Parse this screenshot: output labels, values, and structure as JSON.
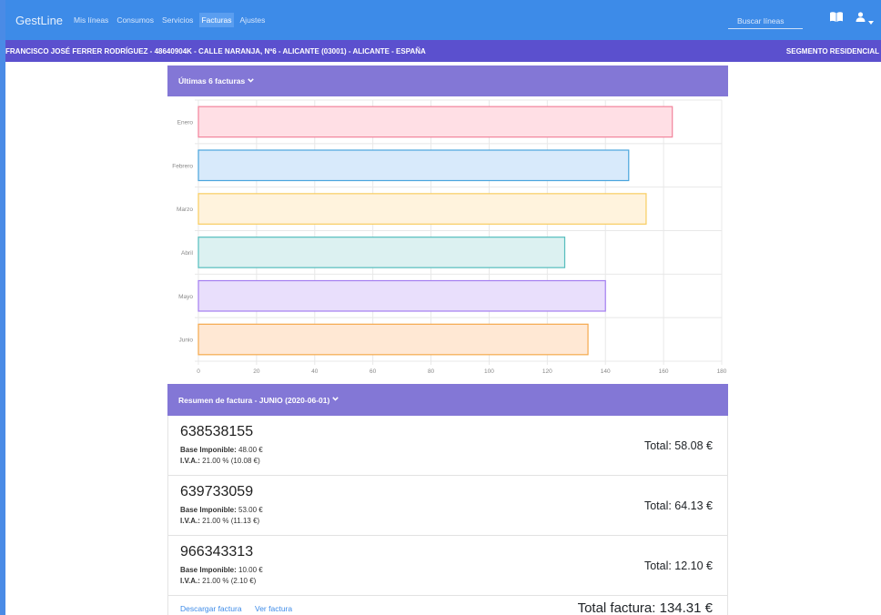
{
  "navbar": {
    "brand": "GestLine",
    "items": [
      {
        "label": "Mis líneas",
        "active": false
      },
      {
        "label": "Consumos",
        "active": false
      },
      {
        "label": "Servicios",
        "active": false
      },
      {
        "label": "Facturas",
        "active": true
      },
      {
        "label": "Ajustes",
        "active": false
      }
    ],
    "search_placeholder": "Buscar líneas",
    "icons": [
      "book-icon",
      "user-icon",
      "caret-down-icon"
    ]
  },
  "customer_bar": {
    "info": "FRANCISCO JOSÉ FERRER RODRÍGUEZ - 48640904K - CALLE NARANJA, Nº6 - ALICANTE (03001) - ALICANTE - ESPAÑA",
    "segment": "SEGMENTO RESIDENCIAL"
  },
  "invoices_panel": {
    "title": "Últimas 6 facturas"
  },
  "chart_data": {
    "type": "bar",
    "orientation": "horizontal",
    "categories": [
      "Enero",
      "Febrero",
      "Marzo",
      "Abril",
      "Mayo",
      "Junio"
    ],
    "values": [
      163,
      148,
      154,
      126,
      140,
      134
    ],
    "xlim": [
      0,
      180
    ],
    "xticks": [
      0,
      20,
      40,
      60,
      80,
      100,
      120,
      140,
      160,
      180
    ],
    "grid": true,
    "colors": [
      {
        "fill": "#ffdfe5",
        "stroke": "#f2839b"
      },
      {
        "fill": "#d8eafb",
        "stroke": "#4aa5dd"
      },
      {
        "fill": "#fff3dd",
        "stroke": "#f8cd60"
      },
      {
        "fill": "#dcf1f1",
        "stroke": "#55bdbd"
      },
      {
        "fill": "#e9dffc",
        "stroke": "#a47ef0"
      },
      {
        "fill": "#ffe8d4",
        "stroke": "#f5a94c"
      }
    ]
  },
  "summary_panel": {
    "title": "Resumen de factura - JUNIO (2020-06-01)",
    "lines": [
      {
        "number": "638538155",
        "base_label": "Base Imponible:",
        "base_value": "48.00 €",
        "iva_label": "I.V.A.:",
        "iva_value": "21.00 % (10.08 €)",
        "total": "Total: 58.08 €"
      },
      {
        "number": "639733059",
        "base_label": "Base Imponible:",
        "base_value": "53.00 €",
        "iva_label": "I.V.A.:",
        "iva_value": "21.00 % (11.13 €)",
        "total": "Total: 64.13 €"
      },
      {
        "number": "966343313",
        "base_label": "Base Imponible:",
        "base_value": "10.00 €",
        "iva_label": "I.V.A.:",
        "iva_value": "21.00 % (2.10 €)",
        "total": "Total: 12.10 €"
      }
    ],
    "download_label": "Descargar factura",
    "view_label": "Ver factura",
    "grand_total": "Total factura: 134.31 €"
  }
}
